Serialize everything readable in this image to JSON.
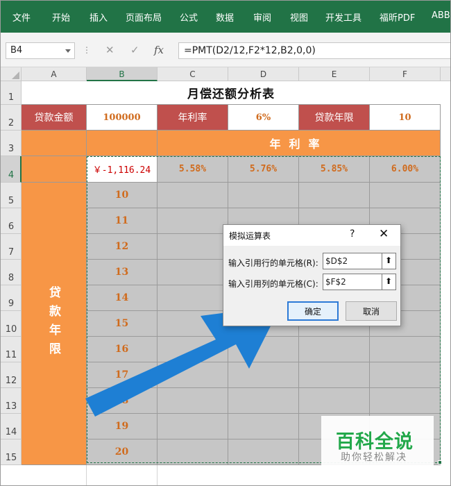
{
  "ribbon": {
    "tabs": [
      "文件",
      "开始",
      "插入",
      "页面布局",
      "公式",
      "数据",
      "审阅",
      "视图",
      "开发工具",
      "福昕PDF",
      "ABB"
    ]
  },
  "formula_bar": {
    "name_box": "B4",
    "dots": "⋮",
    "cancel_icon": "✕",
    "enter_icon": "✓",
    "fx_icon": "fx",
    "formula": "=PMT(D2/12,F2*12,B2,0,0)"
  },
  "columns": [
    "A",
    "B",
    "C",
    "D",
    "E",
    "F"
  ],
  "rows": [
    "1",
    "2",
    "3",
    "4",
    "5",
    "6",
    "7",
    "8",
    "9",
    "10",
    "11",
    "12",
    "13",
    "14",
    "15"
  ],
  "sheet": {
    "title": "月偿还额分析表",
    "loan_amount_label": "贷款金额",
    "loan_amount_value": "100000",
    "rate_label": "年利率",
    "rate_value": "6%",
    "term_label": "贷款年限",
    "term_value": "10",
    "rate_banner": "年利率",
    "pmt_result": "￥-1,116.24",
    "rates": [
      "5.58%",
      "5.76%",
      "5.85%",
      "6.00%"
    ],
    "years": [
      "10",
      "11",
      "12",
      "13",
      "14",
      "15",
      "16",
      "17",
      "18",
      "19",
      "20"
    ],
    "term_side_label": "贷款年限"
  },
  "dialog": {
    "title": "模拟运算表",
    "help": "?",
    "close": "✕",
    "row_label": "输入引用行的单元格(R):",
    "row_value": "$D$2",
    "col_label": "输入引用列的单元格(C):",
    "col_value": "$F$2",
    "ok_label": "确定",
    "cancel_label": "取消",
    "picker_glyph": "⬆"
  },
  "watermark": {
    "title": "百科全说",
    "subtitle": "助你轻松解决"
  },
  "colors": {
    "ribbon": "#217346",
    "header_red": "#c0504d",
    "orange_fill": "#f79646",
    "gray_fill": "#c6c6c6",
    "value_orange": "#d06b1d",
    "arrow_blue": "#1e7fd4",
    "watermark_green": "#22a84a"
  }
}
